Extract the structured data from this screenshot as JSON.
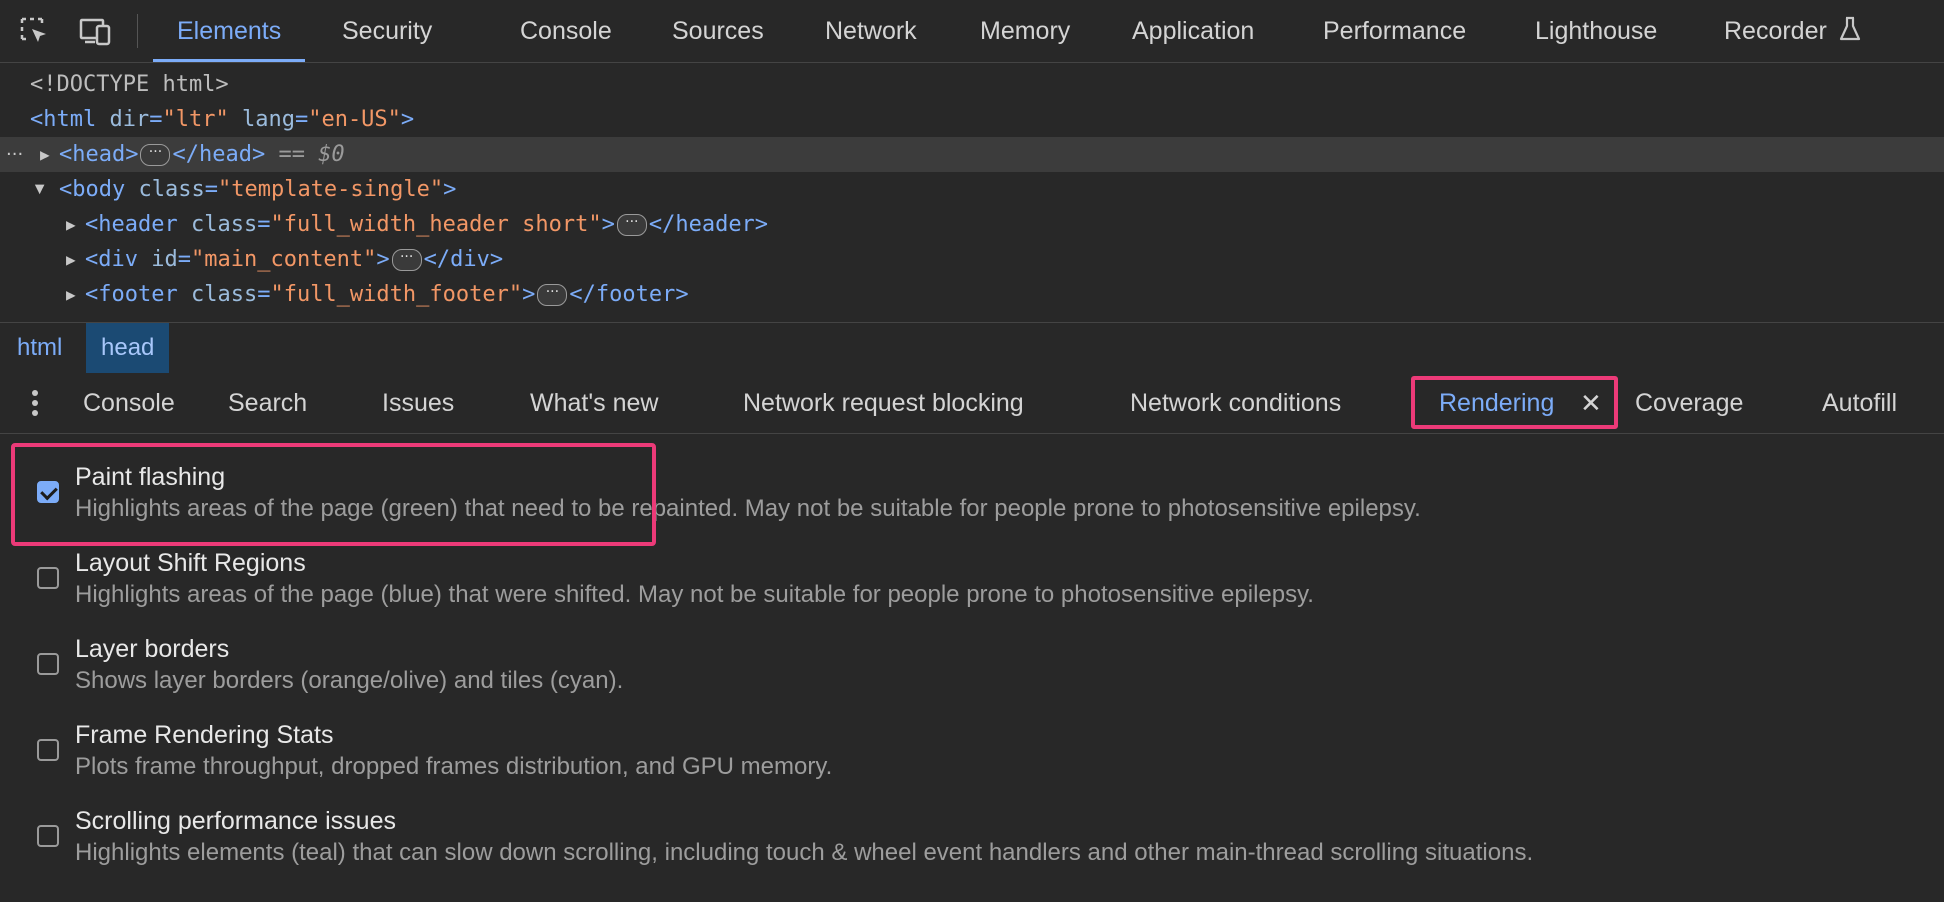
{
  "toolbar": {
    "inspect_icon": "inspect-element-icon",
    "device_icon": "device-toolbar-icon",
    "tabs": [
      {
        "label": "Elements",
        "active": true
      },
      {
        "label": "Security"
      },
      {
        "label": "Console"
      },
      {
        "label": "Sources"
      },
      {
        "label": "Network"
      },
      {
        "label": "Memory"
      },
      {
        "label": "Application"
      },
      {
        "label": "Performance"
      },
      {
        "label": "Lighthouse"
      },
      {
        "label": "Recorder"
      }
    ],
    "recorder_icon": "flask-icon"
  },
  "dom": {
    "doctype": "<!DOCTYPE html>",
    "html_open": "<html",
    "html_attr": "dir",
    "html_attr_val": "\"ltr\"",
    "html_attr2": "lang",
    "html_attr2_val": "\"en-US\"",
    "close_angle": ">",
    "head_open": "<head>",
    "head_close": "</head>",
    "selected_marker": "== $0",
    "body_open": "<body",
    "body_attr": "class",
    "body_attr_val": "\"template-single\"",
    "header_open": "<header",
    "header_attr": "class",
    "header_attr_val": "\"full_width_header short\"",
    "header_close": "</header>",
    "div_open": "<div",
    "div_attr": "id",
    "div_attr_val": "\"main_content\"",
    "div_close": "</div>",
    "footer_open": "<footer",
    "footer_attr": "class",
    "footer_attr_val": "\"full_width_footer\"",
    "footer_close": "</footer>",
    "ellipsis": "···",
    "row_dots": "···"
  },
  "breadcrumb": [
    {
      "label": "html"
    },
    {
      "label": "head",
      "active": true
    }
  ],
  "drawer": {
    "menu_icon": "kebab-menu-icon",
    "tabs": [
      {
        "label": "Console"
      },
      {
        "label": "Search"
      },
      {
        "label": "Issues"
      },
      {
        "label": "What's new"
      },
      {
        "label": "Network request blocking"
      },
      {
        "label": "Network conditions"
      },
      {
        "label": "Rendering",
        "active": true
      },
      {
        "label": "Coverage"
      },
      {
        "label": "Autofill"
      }
    ],
    "close_label": "✕"
  },
  "rendering": {
    "options": [
      {
        "title": "Paint flashing",
        "desc": "Highlights areas of the page (green) that need to be repainted. May not be suitable for people prone to photosensitive epilepsy.",
        "checked": true
      },
      {
        "title": "Layout Shift Regions",
        "desc": "Highlights areas of the page (blue) that were shifted. May not be suitable for people prone to photosensitive epilepsy.",
        "checked": false
      },
      {
        "title": "Layer borders",
        "desc": "Shows layer borders (orange/olive) and tiles (cyan).",
        "checked": false
      },
      {
        "title": "Frame Rendering Stats",
        "desc": "Plots frame throughput, dropped frames distribution, and GPU memory.",
        "checked": false
      },
      {
        "title": "Scrolling performance issues",
        "desc": "Highlights elements (teal) that can slow down scrolling, including touch & wheel event handlers and other main-thread scrolling situations.",
        "checked": false
      }
    ]
  },
  "colors": {
    "accent": "#7cacf8",
    "highlight": "#ec3a78",
    "background": "#282828"
  }
}
